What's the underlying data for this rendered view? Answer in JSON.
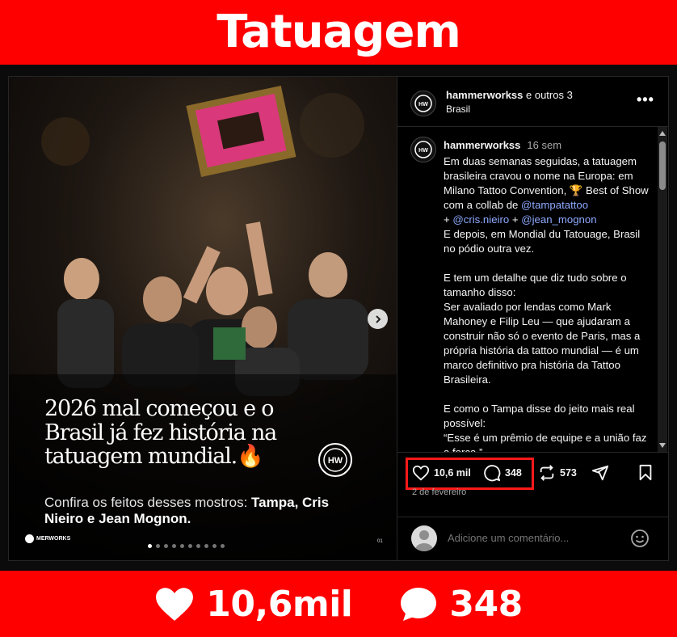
{
  "banner": {
    "title": "Tatuagem"
  },
  "photo": {
    "headline": "2026 mal começou e o Brasil já fez história na tatuagem mundial.🔥",
    "sub_prefix": "Confira os feitos desses mostros: ",
    "sub_bold": "Tampa, Cris Nieiro e Jean Mognon.",
    "brand_tag": "MERWORKS",
    "page_num": "01",
    "logo_letters": "HW",
    "carousel_total": 10,
    "carousel_active": 0
  },
  "post_header": {
    "username": "hammerworkss",
    "others": " e outros 3",
    "location": "Brasil",
    "more": "•••"
  },
  "caption": {
    "username": "hammerworkss",
    "time": "16 sem",
    "line1": "Em duas semanas seguidas, a tatuagem brasileira cravou o nome na Europa: em Milano Tattoo Convention, 🏆 Best of Show com a collab de ",
    "m1": "@tampatattoo",
    "plus1": "\n+ ",
    "m2": "@cris.nieiro",
    "plus2": " + ",
    "m3": "@jean_mognon",
    "line2": "\nE depois, em Mondial du Tatouage, Brasil no pódio outra vez.\n\nE tem um detalhe que diz tudo sobre o tamanho disso:\nSer avaliado por lendas como Mark Mahoney e Filip Leu — que ajudaram a construir não só o evento de Paris, mas a própria história da tattoo mundial — é um marco definitivo pra história da Tattoo Brasileira.\n\nE como o Tampa disse do jeito mais real possível:\n“Esse é um prêmio de equipe e a união faz a força.”"
  },
  "actions": {
    "likes": "10,6 mil",
    "comments": "348",
    "reposts": "573",
    "date": "2 de fevereiro"
  },
  "comment_box": {
    "placeholder": "Adicione um comentário..."
  },
  "summary": {
    "likes": "10,6mil",
    "comments": "348"
  },
  "colors": {
    "accent_red": "#ff0000",
    "highlight": "#ff1a1a",
    "mention": "#8ea9ff"
  },
  "icons": [
    "heart-icon",
    "comment-icon",
    "repost-icon",
    "share-icon",
    "bookmark-icon",
    "emoji-icon",
    "more-icon",
    "chevron-right-icon"
  ]
}
